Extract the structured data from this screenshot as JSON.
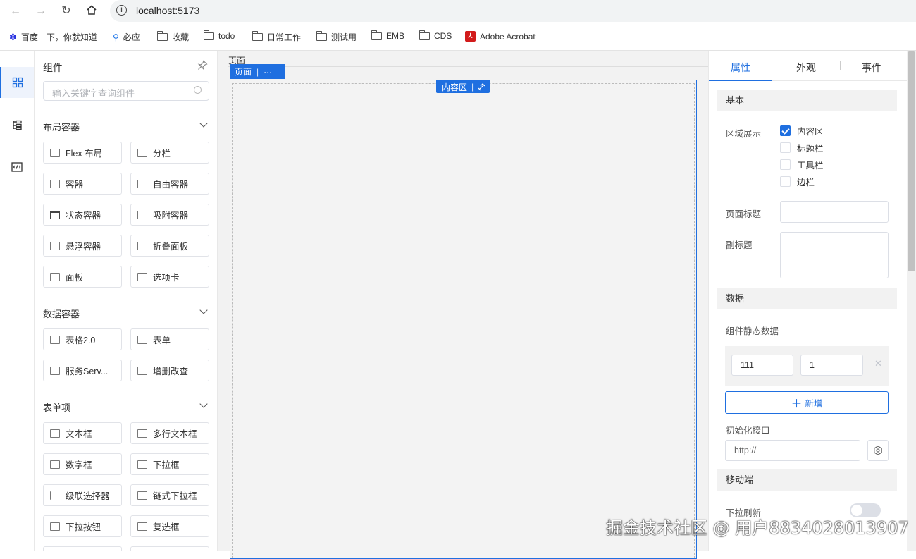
{
  "browser": {
    "url": "localhost:5173",
    "bookmarks": [
      "百度一下，你就知道",
      "必应",
      "收藏",
      "todo",
      "日常工作",
      "测试用",
      "EMB",
      "CDS",
      "Adobe Acrobat"
    ]
  },
  "rail": {
    "items": [
      "components-icon",
      "outline-icon",
      "code-icon"
    ]
  },
  "panel": {
    "title": "组件",
    "search_placeholder": "输入关键字查询组件",
    "sections": [
      {
        "title": "布局容器",
        "items": [
          "Flex 布局",
          "分栏",
          "容器",
          "自由容器",
          "状态容器",
          "吸附容器",
          "悬浮容器",
          "折叠面板",
          "面板",
          "选项卡"
        ]
      },
      {
        "title": "数据容器",
        "items": [
          "表格2.0",
          "表单",
          "服务Serv...",
          "增删改查"
        ]
      },
      {
        "title": "表单项",
        "items": [
          "文本框",
          "多行文本框",
          "数字框",
          "下拉框",
          "级联选择器",
          "链式下拉框",
          "下拉按钮",
          "复选框"
        ]
      }
    ]
  },
  "canvas": {
    "breadcrumb": "页面",
    "page_tag": "页面",
    "page_tag_more": "···",
    "content_tag": "内容区"
  },
  "props": {
    "tabs": [
      "属性",
      "外观",
      "事件"
    ],
    "groups": {
      "basic": "基本",
      "data": "数据",
      "mobile": "移动端"
    },
    "region_label": "区域展示",
    "regions": [
      {
        "label": "内容区",
        "checked": true
      },
      {
        "label": "标题栏",
        "checked": false
      },
      {
        "label": "工具栏",
        "checked": false
      },
      {
        "label": "边栏",
        "checked": false
      }
    ],
    "page_title_label": "页面标题",
    "page_title_value": "",
    "subtitle_label": "副标题",
    "subtitle_value": "",
    "static_data_label": "组件静态数据",
    "static_key": "111",
    "static_value": "1",
    "add_label": "新增",
    "init_api_label": "初始化接口",
    "init_api_value": "http://",
    "pull_refresh_label": "下拉刷新",
    "pull_refresh_on": false
  },
  "watermark": "掘金技术社区 @ 用户8834028013907",
  "colors": {
    "accent": "#1f6fe0"
  }
}
